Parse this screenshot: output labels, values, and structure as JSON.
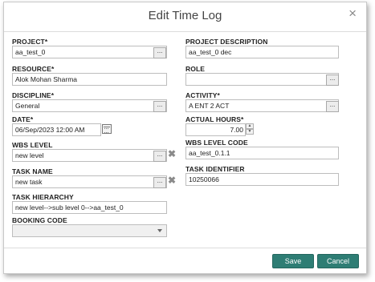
{
  "dialog": {
    "title": "Edit Time Log",
    "close": "×"
  },
  "left": {
    "project": {
      "label": "PROJECT*",
      "value": "aa_test_0"
    },
    "resource": {
      "label": "RESOURCE*",
      "value": "Alok Mohan Sharma"
    },
    "discipline": {
      "label": "DISCIPLINE*",
      "value": "General"
    },
    "date": {
      "label": "DATE*",
      "value": "06/Sep/2023 12:00 AM"
    },
    "wbs_level": {
      "label": "WBS LEVEL",
      "value": "new level"
    },
    "task_name": {
      "label": "TASK NAME",
      "value": "new task"
    },
    "task_hierarchy": {
      "label": "TASK HIERARCHY",
      "value": "new level-->sub level 0-->aa_test_0"
    },
    "booking_code": {
      "label": "BOOKING CODE",
      "value": ""
    }
  },
  "right": {
    "project_description": {
      "label": "PROJECT DESCRIPTION",
      "value": "aa_test_0 dec"
    },
    "role": {
      "label": "ROLE",
      "value": ""
    },
    "activity": {
      "label": "ACTIVITY*",
      "value": "A ENT 2 ACT"
    },
    "actual_hours": {
      "label": "ACTUAL HOURS*",
      "value": "7.00"
    },
    "wbs_level_code": {
      "label": "WBS LEVEL CODE",
      "value": "aa_test_0.1.1"
    },
    "task_identifier": {
      "label": "TASK IDENTIFIER",
      "value": "10250066"
    }
  },
  "icons": {
    "dots": "...",
    "clear": "✖",
    "spin_up": "▲",
    "spin_down": "▼"
  },
  "footer": {
    "save": "Save",
    "cancel": "Cancel"
  },
  "colors": {
    "button": "#2e7d74"
  }
}
